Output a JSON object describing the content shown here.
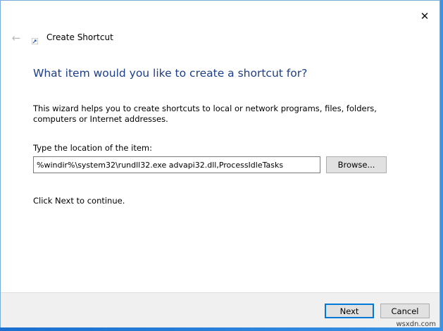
{
  "window": {
    "title": "Create Shortcut",
    "close_glyph": "✕",
    "back_glyph": "←"
  },
  "wizard": {
    "heading": "What item would you like to create a shortcut for?",
    "description": "This wizard helps you to create shortcuts to local or network programs, files, folders, computers or Internet addresses.",
    "location_label": "Type the location of the item:",
    "location_value": "%windir%\\system32\\rundll32.exe advapi32.dll,ProcessIdleTasks",
    "browse_label": "Browse...",
    "hint": "Click Next to continue."
  },
  "footer": {
    "next_label": "Next",
    "cancel_label": "Cancel"
  },
  "watermark": "wsxdn.com",
  "colors": {
    "heading": "#1d3e88",
    "accent": "#0078d7",
    "desktop": "#2c7fd6"
  },
  "icons": {
    "back": "back-arrow-icon",
    "close": "close-icon",
    "app": "shortcut-icon"
  }
}
